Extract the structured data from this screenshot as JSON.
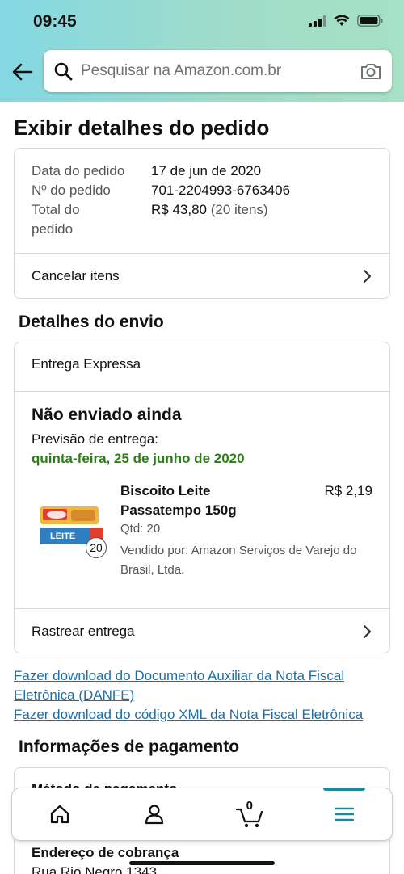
{
  "status_bar": {
    "time": "09:45"
  },
  "search": {
    "placeholder": "Pesquisar na Amazon.com.br"
  },
  "page": {
    "title": "Exibir detalhes do pedido"
  },
  "order_summary": {
    "date_label": "Data do pedido",
    "date_value": "17 de jun de 2020",
    "number_label": "Nº do pedido",
    "number_value": "701-2204993-6763406",
    "total_label": "Total do pedido",
    "total_value": "R$ 43,80",
    "total_items": "(20 itens)",
    "cancel_label": "Cancelar itens"
  },
  "shipping": {
    "section_title": "Detalhes do envio",
    "method": "Entrega Expressa",
    "status": "Não enviado ainda",
    "forecast_label": "Previsão de entrega:",
    "forecast_date": "quinta-feira, 25 de junho de 2020",
    "product": {
      "name": "Biscoito Leite Passatempo 150g",
      "price": "R$ 2,19",
      "qty": "Qtd: 20",
      "seller": "Vendido por: Amazon Serviços de Varejo do Brasil, Ltda.",
      "badge": "20",
      "image_text": "LEITE"
    },
    "track_label": "Rastrear entrega"
  },
  "links": {
    "danfe": "Fazer download do Documento Auxiliar da Nota Fiscal Eletrônica (DANFE)",
    "xml": "Fazer download do código XML da Nota Fiscal Eletrônica"
  },
  "payment": {
    "section_title": "Informações de pagamento",
    "method_label": "Método de pagamento",
    "billing_label": "Endereço de cobrança",
    "billing_address": "Rua Rio Negro 1343"
  },
  "bottom_nav": {
    "cart_count": "0"
  },
  "colors": {
    "accent": "#1a8a9a",
    "link": "#1f6ea8",
    "delivery_green": "#2e7d1a"
  }
}
